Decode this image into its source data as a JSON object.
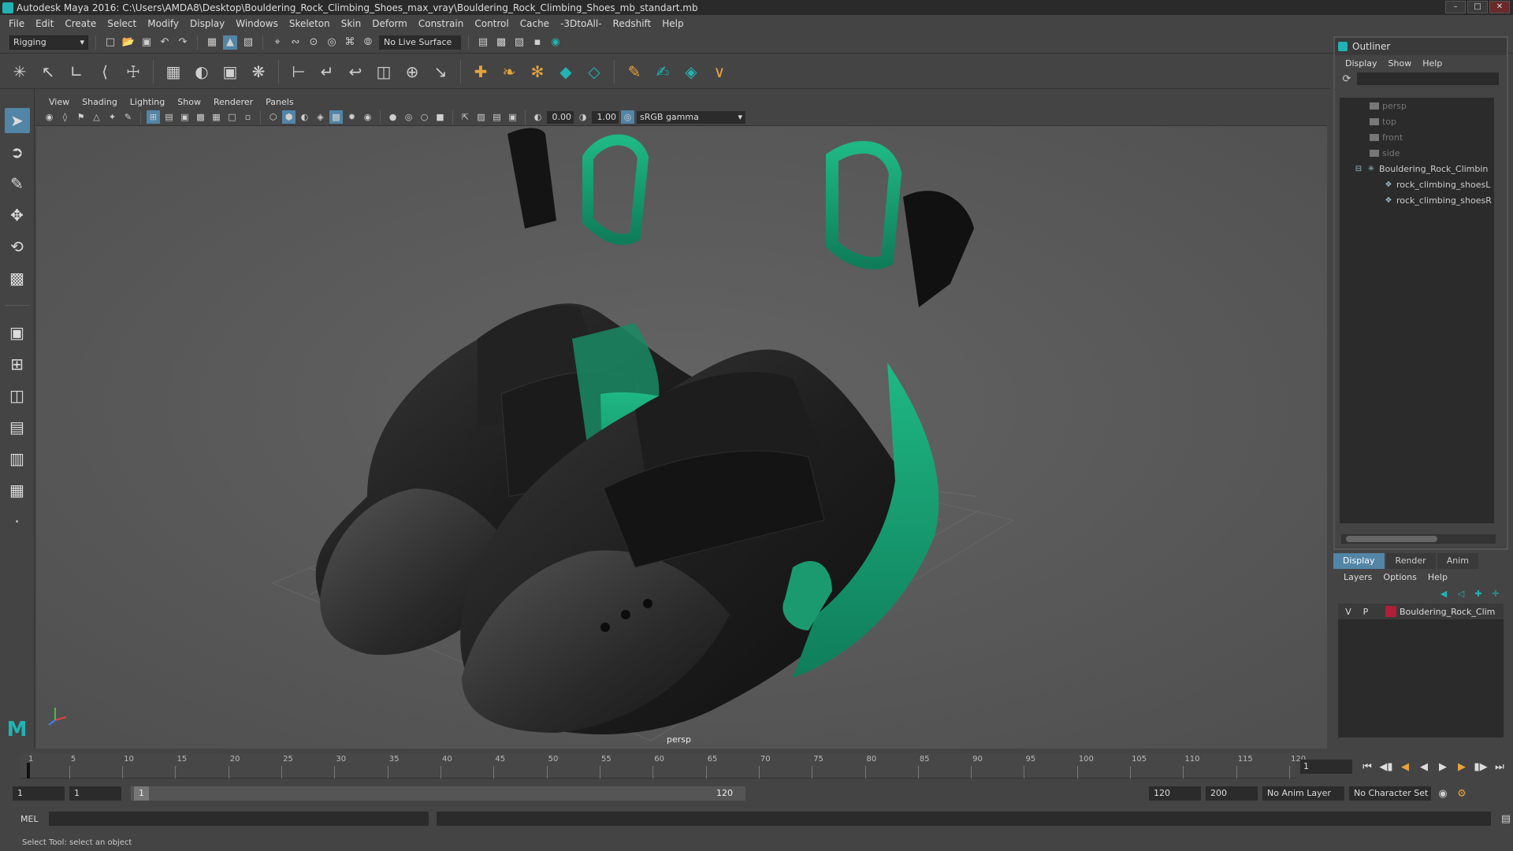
{
  "window": {
    "title": "Autodesk Maya 2016: C:\\Users\\AMDA8\\Desktop\\Bouldering_Rock_Climbing_Shoes_max_vray\\Bouldering_Rock_Climbing_Shoes_mb_standart.mb",
    "minimize": "–",
    "maximize": "□",
    "close": "✕"
  },
  "menubar": [
    "File",
    "Edit",
    "Create",
    "Select",
    "Modify",
    "Display",
    "Windows",
    "Skeleton",
    "Skin",
    "Deform",
    "Constrain",
    "Control",
    "Cache",
    "-3DtoAll-",
    "Redshift",
    "Help"
  ],
  "statusline": {
    "menuset": "Rigging",
    "menuset_arrow": "▾",
    "live_surface": "No Live Surface"
  },
  "panel": {
    "menus": [
      "View",
      "Shading",
      "Lighting",
      "Show",
      "Renderer",
      "Panels"
    ],
    "exposure": "0.00",
    "gamma": "1.00",
    "color_space": "sRGB gamma",
    "color_space_arrow": "▾",
    "camera": "persp"
  },
  "outliner": {
    "title": "Outliner",
    "menus": [
      "Display",
      "Show",
      "Help"
    ],
    "items": [
      {
        "label": "persp",
        "dim": true
      },
      {
        "label": "top",
        "dim": true
      },
      {
        "label": "front",
        "dim": true
      },
      {
        "label": "side",
        "dim": true
      },
      {
        "label": "Bouldering_Rock_Climbin",
        "dim": false
      },
      {
        "label": "rock_climbing_shoesL",
        "dim": false
      },
      {
        "label": "rock_climbing_shoesR",
        "dim": false
      }
    ]
  },
  "layer_editor": {
    "tabs": [
      "Display",
      "Render",
      "Anim"
    ],
    "menus": [
      "Layers",
      "Options",
      "Help"
    ],
    "layer": {
      "v": "V",
      "p": "P",
      "name": "Bouldering_Rock_Clim",
      "color": "#b01e3a"
    }
  },
  "timeslider": {
    "ticks": [
      1,
      5,
      10,
      15,
      20,
      25,
      30,
      35,
      40,
      45,
      50,
      55,
      60,
      65,
      70,
      75,
      80,
      85,
      90,
      95,
      100,
      105,
      110,
      115,
      120
    ],
    "current_frame": "1"
  },
  "rangeslider": {
    "start": "1",
    "playback_start": "1",
    "range_start": "1",
    "range_end": "120",
    "playback_end": "120",
    "end": "200",
    "anim_layer": "No Anim Layer",
    "character_set": "No Character Set"
  },
  "cmdline": {
    "language": "MEL"
  },
  "helpline": {
    "text": "Select Tool: select an object"
  },
  "colors": {
    "accent": "#5285a6",
    "maya_teal": "#21b3b3",
    "shoe_green": "#18a07a"
  }
}
